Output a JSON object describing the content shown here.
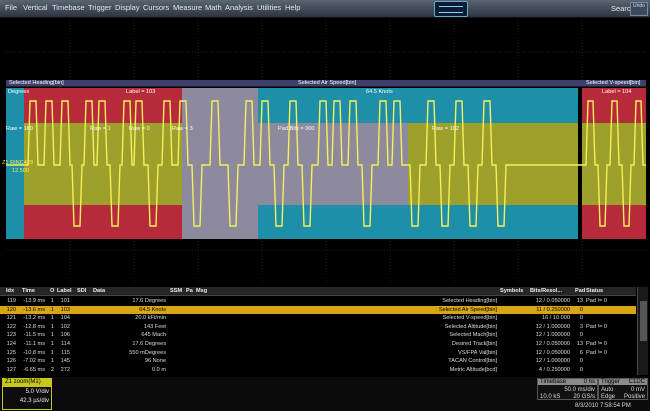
{
  "menu": [
    "File",
    "Vertical",
    "Timebase",
    "Trigger",
    "Display",
    "Cursors",
    "Measure",
    "Math",
    "Analysis",
    "Utilities",
    "Help"
  ],
  "search_label": "Search",
  "undo_label": "Undo",
  "decode_header": {
    "left": "Selected Heading[bin]",
    "center": "Selected Air Speed[bin]",
    "right": "Selected V-speed[bin]"
  },
  "decode_cells": {
    "degrees": "Degrees",
    "label103": "Label = 103",
    "knots": "64.5 Knots",
    "label104": "Label = 104",
    "raw160": "Raw = 160",
    "raw1": "Raw = 1",
    "raw0": "Raw = 0",
    "raw3": "Raw = 3",
    "padbits": "Pad Bits = 000",
    "raw102": "Raw = 102",
    "ch_marker": "Z1 RINC429",
    "ch_value": "12.500"
  },
  "table": {
    "headers": [
      "Idx",
      "Time",
      "O",
      "Label",
      "SDI",
      "Data",
      "SSM",
      "Pa",
      "Msg",
      "Symbols",
      "Bits/Resol...",
      "Pad",
      "Status"
    ],
    "rows": [
      {
        "idx": "119",
        "time": "-13.9 ms",
        "o": "1",
        "label": "101",
        "sdi": "",
        "data": "17.6 Degrees",
        "ssm": "",
        "pa": "",
        "msg": "Selected Heading[bin]",
        "sym": "",
        "bits": "12 / 0.050000",
        "pad": "13",
        "status": "Pad != 0"
      },
      {
        "idx": "120",
        "time": "-13.6 ms",
        "o": "1",
        "label": "103",
        "sdi": "",
        "data": "64.5 Knots",
        "ssm": "",
        "pa": "",
        "msg": "Selected Air Speed[bin]",
        "sym": "",
        "bits": "11 / 0.250000",
        "pad": "0",
        "status": ""
      },
      {
        "idx": "121",
        "time": "-13.2 ms",
        "o": "1",
        "label": "104",
        "sdi": "",
        "data": "20.0 kFt/min",
        "ssm": "",
        "pa": "",
        "msg": "Selected V-speed[bin]",
        "sym": "",
        "bits": "16 / 10.000",
        "pad": "0",
        "status": ""
      },
      {
        "idx": "122",
        "time": "-12.8 ms",
        "o": "1",
        "label": "102",
        "sdi": "",
        "data": "143 Feet",
        "ssm": "",
        "pa": "",
        "msg": "Selected Altitude[bin]",
        "sym": "",
        "bits": "12 / 1.000000",
        "pad": "3",
        "status": "Pad != 0"
      },
      {
        "idx": "123",
        "time": "-11.5 ms",
        "o": "1",
        "label": "106",
        "sdi": "",
        "data": "645 Mach",
        "ssm": "",
        "pa": "",
        "msg": "Selected Mach[bin]",
        "sym": "",
        "bits": "12 / 1.000000",
        "pad": "0",
        "status": ""
      },
      {
        "idx": "124",
        "time": "-11.1 ms",
        "o": "1",
        "label": "114",
        "sdi": "",
        "data": "17.6 Degrees",
        "ssm": "",
        "pa": "",
        "msg": "Desired Track[bin]",
        "sym": "",
        "bits": "12 / 0.050000",
        "pad": "13",
        "status": "Pad != 0"
      },
      {
        "idx": "125",
        "time": "-10.8 ms",
        "o": "1",
        "label": "115",
        "sdi": "",
        "data": "550 mDegrees",
        "ssm": "",
        "pa": "",
        "msg": "VS/FPA Val[bin]",
        "sym": "",
        "bits": "12 / 0.050000",
        "pad": "6",
        "status": "Pad != 0"
      },
      {
        "idx": "126",
        "time": "-7.02 ms",
        "o": "1",
        "label": "145",
        "sdi": "",
        "data": "96 None",
        "ssm": "",
        "pa": "",
        "msg": "TACAN Control[bin]",
        "sym": "",
        "bits": "12 / 1.000000",
        "pad": "0",
        "status": ""
      },
      {
        "idx": "127",
        "time": "-6.65 ms",
        "o": "2",
        "label": "272",
        "sdi": "",
        "data": "0.0 m",
        "ssm": "",
        "pa": "",
        "msg": "Metric Altitude[bcd]",
        "sym": "",
        "bits": "4 / 0.250000",
        "pad": "0",
        "status": ""
      }
    ]
  },
  "channel": {
    "name": "Z1",
    "title": "zoom(M1)",
    "v1": "5.0 V/div",
    "v2": "42.3 µs/div"
  },
  "timebase": {
    "title": "Timebase",
    "offset": "0 ns",
    "tdiv": "50.0 ms/div",
    "samples": "10.0 kS",
    "rate": "20 GS/s"
  },
  "trigger": {
    "title": "Trigger",
    "badge": "C1DC",
    "mode": "Auto",
    "level": "0 mV",
    "type": "Edge",
    "slope": "Positive"
  },
  "datetime": "8/3/2010 7:58:54 PM",
  "colors": {
    "trace": "#f5f05a",
    "red": "#b62a3c",
    "blue": "#1e8fa8",
    "olive": "#9da02a",
    "gray": "#8c8a9c",
    "selected_row": "#d8a515"
  }
}
